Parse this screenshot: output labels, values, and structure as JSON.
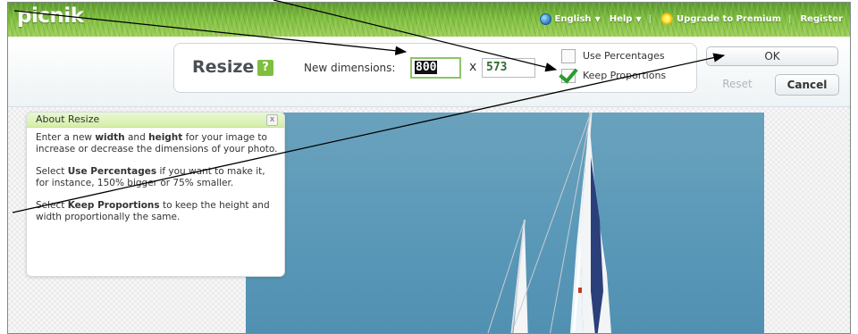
{
  "header": {
    "logo": "picnik",
    "nav": {
      "language": "English",
      "help": "Help",
      "upgrade": "Upgrade to Premium",
      "separator": "|",
      "register": "Register"
    }
  },
  "resize_panel": {
    "title": "Resize",
    "help_label": "?",
    "dimensions_label": "New dimensions:",
    "width_value": "800",
    "times_symbol": "x",
    "height_value": "573",
    "use_percentages_label": "Use Percentages",
    "use_percentages_checked": false,
    "keep_proportions_label": "Keep Proportions",
    "keep_proportions_checked": true
  },
  "buttons": {
    "ok": "OK",
    "reset": "Reset",
    "cancel": "Cancel"
  },
  "about_panel": {
    "title": "About Resize",
    "close_label": "x",
    "p1_before": "Enter a new ",
    "p1_width": "width",
    "p1_and": " and ",
    "p1_height": "height",
    "p1_after": " for your image to increase or decrease the dimensions of your photo.",
    "p2_before": "Select ",
    "p2_bold": "Use Percentages",
    "p2_after": " if you want to make it, for instance, 150% bigger or 75% smaller.",
    "p3_before": "Select ",
    "p3_bold": "Keep Proportions",
    "p3_after": " to keep the height and width proportionally the same."
  },
  "colors": {
    "accent_green": "#7fbf3f",
    "sky_blue": "#5a98b8",
    "check_green": "#2c9a2c"
  },
  "icons": [
    "globe-icon",
    "chevron-down-icon",
    "sun-icon",
    "help-icon",
    "checkmark-icon",
    "close-icon"
  ]
}
